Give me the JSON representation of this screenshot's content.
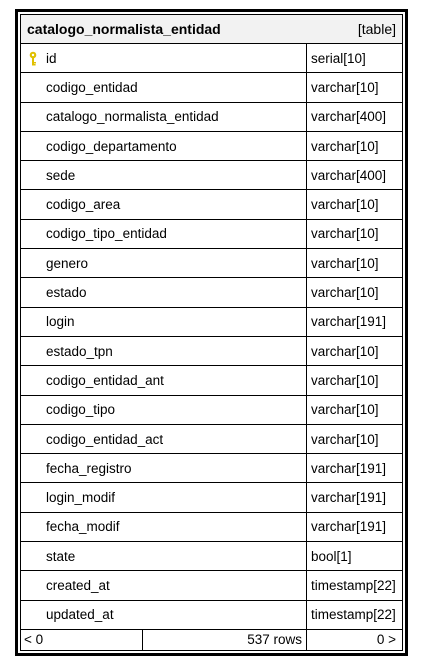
{
  "table": {
    "name": "catalogo_normalista_entidad",
    "kind": "[table]",
    "columns": [
      {
        "name": "id",
        "type": "serial[10]",
        "primary_key": true
      },
      {
        "name": "codigo_entidad",
        "type": "varchar[10]"
      },
      {
        "name": "catalogo_normalista_entidad",
        "type": "varchar[400]"
      },
      {
        "name": "codigo_departamento",
        "type": "varchar[10]"
      },
      {
        "name": "sede",
        "type": "varchar[400]"
      },
      {
        "name": "codigo_area",
        "type": "varchar[10]"
      },
      {
        "name": "codigo_tipo_entidad",
        "type": "varchar[10]"
      },
      {
        "name": "genero",
        "type": "varchar[10]"
      },
      {
        "name": "estado",
        "type": "varchar[10]"
      },
      {
        "name": "login",
        "type": "varchar[191]"
      },
      {
        "name": "estado_tpn",
        "type": "varchar[10]"
      },
      {
        "name": "codigo_entidad_ant",
        "type": "varchar[10]"
      },
      {
        "name": "codigo_tipo",
        "type": "varchar[10]"
      },
      {
        "name": "codigo_entidad_act",
        "type": "varchar[10]"
      },
      {
        "name": "fecha_registro",
        "type": "varchar[191]"
      },
      {
        "name": "login_modif",
        "type": "varchar[191]"
      },
      {
        "name": "fecha_modif",
        "type": "varchar[191]"
      },
      {
        "name": "state",
        "type": "bool[1]"
      },
      {
        "name": "created_at",
        "type": "timestamp[22]"
      },
      {
        "name": "updated_at",
        "type": "timestamp[22]"
      }
    ],
    "footer": {
      "left": "< 0",
      "rows": "537 rows",
      "right": "0 >"
    }
  },
  "colors": {
    "border": "#000000",
    "header_bg": "#f2f2f2",
    "key_icon": "#e0c000"
  }
}
